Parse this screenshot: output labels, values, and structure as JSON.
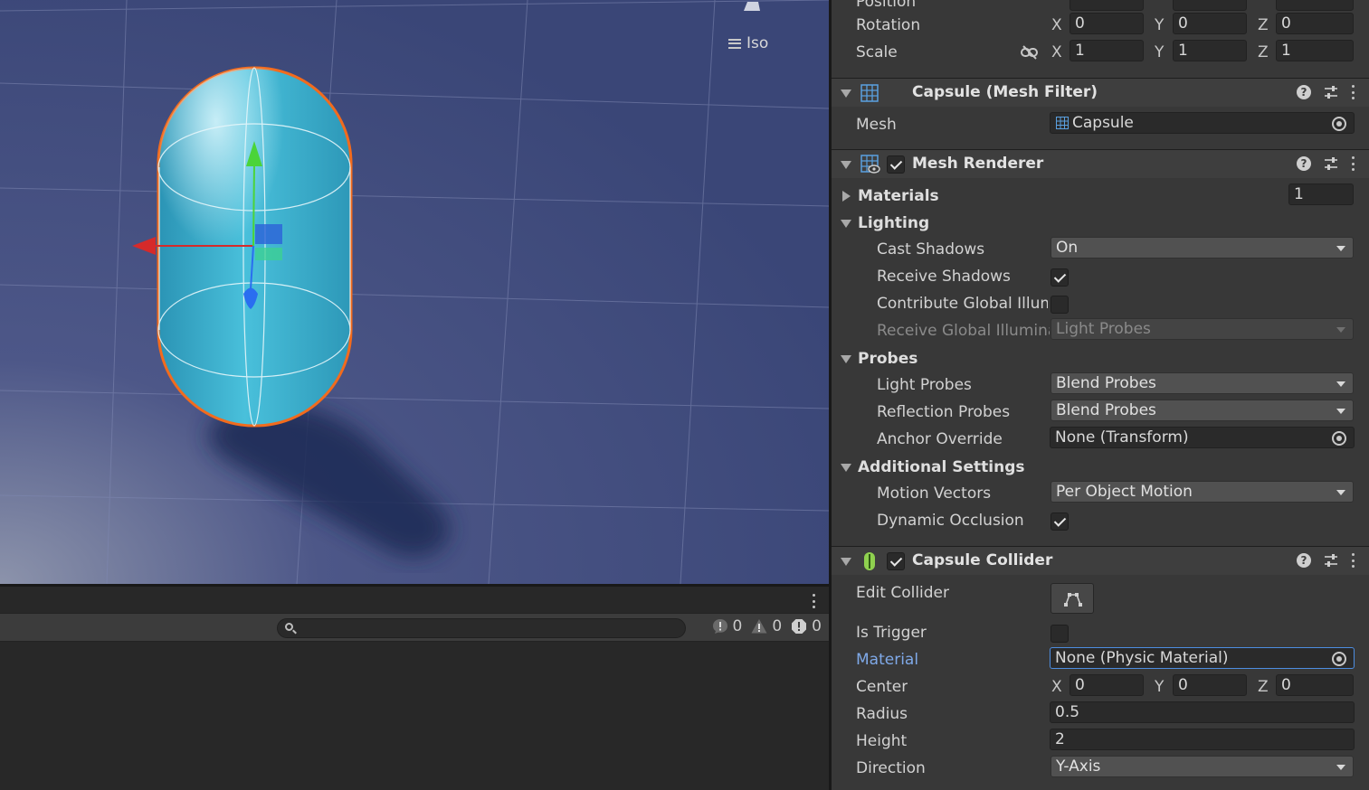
{
  "scene": {
    "view_mode_label": "Iso",
    "icons": [
      "iso-menu-icon",
      "gizmo-icon"
    ]
  },
  "console": {
    "search_placeholder": "",
    "log_count": "0",
    "warning_count": "0",
    "error_count": "0"
  },
  "transform": {
    "position_label": "Position",
    "rotation_label": "Rotation",
    "scale_label": "Scale",
    "rotation": {
      "x": "0",
      "y": "0",
      "z": "0"
    },
    "scale": {
      "x": "1",
      "y": "1",
      "z": "1"
    },
    "axis": {
      "x": "X",
      "y": "Y",
      "z": "Z"
    }
  },
  "mesh_filter": {
    "title": "Capsule (Mesh Filter)",
    "mesh_label": "Mesh",
    "mesh_value": "Capsule"
  },
  "mesh_renderer": {
    "title": "Mesh Renderer",
    "enabled": true,
    "materials_label": "Materials",
    "materials_count": "1",
    "lighting_label": "Lighting",
    "cast_shadows_label": "Cast Shadows",
    "cast_shadows_value": "On",
    "receive_shadows_label": "Receive Shadows",
    "receive_shadows": true,
    "contribute_gi_label": "Contribute Global Illumination",
    "contribute_gi": false,
    "receive_gi_label": "Receive Global Illumination",
    "receive_gi_value": "Light Probes",
    "probes_label": "Probes",
    "light_probes_label": "Light Probes",
    "light_probes_value": "Blend Probes",
    "reflection_probes_label": "Reflection Probes",
    "reflection_probes_value": "Blend Probes",
    "anchor_override_label": "Anchor Override",
    "anchor_override_value": "None (Transform)",
    "additional_settings_label": "Additional Settings",
    "motion_vectors_label": "Motion Vectors",
    "motion_vectors_value": "Per Object Motion",
    "dynamic_occlusion_label": "Dynamic Occlusion",
    "dynamic_occlusion": true
  },
  "capsule_collider": {
    "title": "Capsule Collider",
    "enabled": true,
    "edit_collider_label": "Edit Collider",
    "is_trigger_label": "Is Trigger",
    "is_trigger": false,
    "material_label": "Material",
    "material_value": "None (Physic Material)",
    "center_label": "Center",
    "center": {
      "x": "0",
      "y": "0",
      "z": "0"
    },
    "radius_label": "Radius",
    "radius_value": "0.5",
    "height_label": "Height",
    "height_value": "2",
    "direction_label": "Direction",
    "direction_value": "Y-Axis"
  },
  "colors": {
    "scene_bg": "#3d4a7a",
    "capsule": "#3fb6d2",
    "selection_outline": "#f26b1d",
    "inspector_bg": "#383838",
    "accent_blue": "#4d8de0"
  }
}
